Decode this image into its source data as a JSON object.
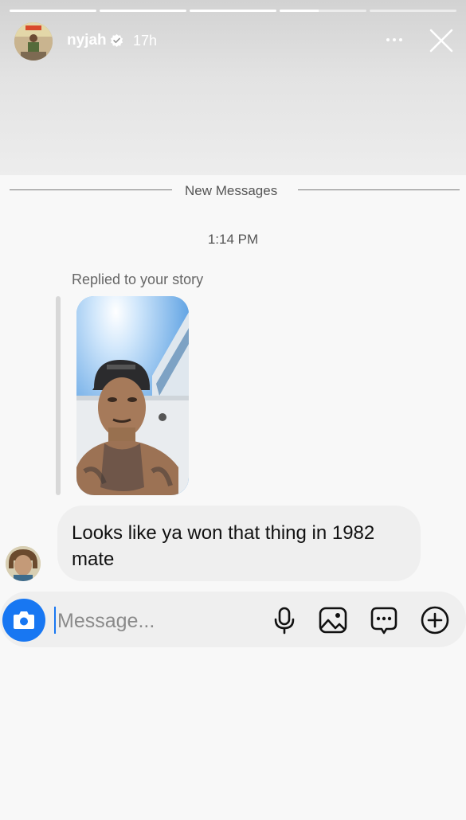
{
  "story": {
    "progress": [
      1,
      1,
      1,
      0.45,
      0
    ],
    "username": "nyjah",
    "time": "17h",
    "icons": {
      "more": "more-horizontal-icon",
      "close": "close-icon",
      "verified": "verified-badge-icon"
    }
  },
  "thread": {
    "divider_label": "New Messages",
    "timestamp": "1:14 PM",
    "reply_context": "Replied to your story",
    "message": "Looks like ya won that thing in 1982 mate"
  },
  "composer": {
    "placeholder": "Message...",
    "icons": [
      "camera-icon",
      "microphone-icon",
      "gallery-icon",
      "sticker-icon",
      "add-icon"
    ]
  },
  "colors": {
    "accent": "#1877f2",
    "bubble": "#efefef",
    "background": "#f8f8f8"
  }
}
